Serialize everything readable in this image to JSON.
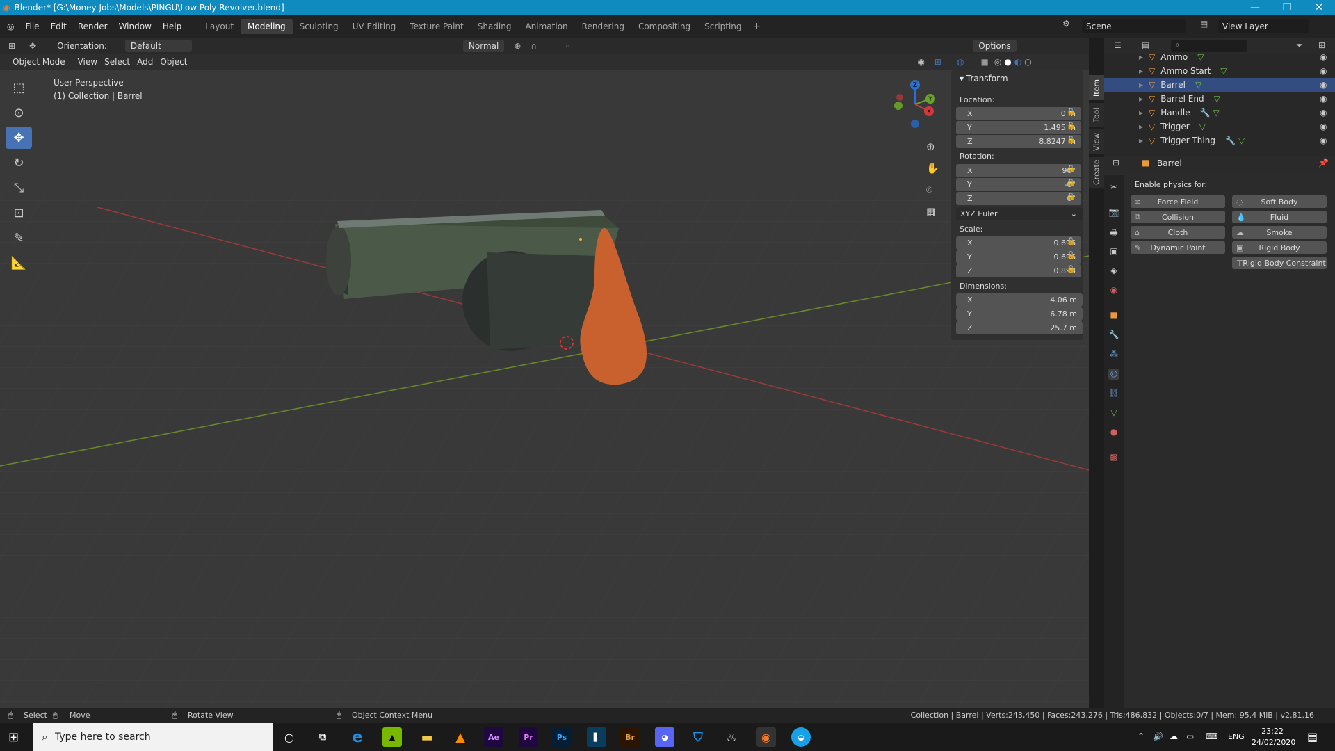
{
  "titlebar": {
    "title": "Blender* [G:\\Money Jobs\\Models\\PINGU\\Low Poly Revolver.blend]"
  },
  "menu": [
    "File",
    "Edit",
    "Render",
    "Window",
    "Help"
  ],
  "workspaces": [
    "Layout",
    "Modeling",
    "Sculpting",
    "UV Editing",
    "Texture Paint",
    "Shading",
    "Animation",
    "Rendering",
    "Compositing",
    "Scripting"
  ],
  "active_workspace": "Modeling",
  "scene": {
    "label": "Scene"
  },
  "viewlayer": {
    "label": "View Layer"
  },
  "header": {
    "orientation_label": "Orientation:",
    "orientation_value": "Default",
    "pivot": "Normal",
    "options": "Options"
  },
  "header2": {
    "mode": "Object Mode",
    "view": "View",
    "select": "Select",
    "add": "Add",
    "object": "Object"
  },
  "viewport": {
    "perspective": "User Perspective",
    "collection": "(1) Collection | Barrel"
  },
  "npanel": {
    "title": "Transform",
    "location_label": "Location:",
    "location": {
      "x": "0 m",
      "y": "1.495 m",
      "z": "8.8247 m"
    },
    "rotation_label": "Rotation:",
    "rotation": {
      "x": "90°",
      "y": "-0°",
      "z": "0°"
    },
    "euler": "XYZ Euler",
    "scale_label": "Scale:",
    "scale": {
      "x": "0.696",
      "y": "0.696",
      "z": "0.893"
    },
    "dimensions_label": "Dimensions:",
    "dimensions": {
      "x": "4.06 m",
      "y": "6.78 m",
      "z": "25.7 m"
    },
    "tabs": [
      "Item",
      "Tool",
      "View",
      "Create"
    ]
  },
  "axis_labels": {
    "x": "X",
    "y": "Y",
    "z": "Z"
  },
  "outliner": {
    "items": [
      "Ammo",
      "Ammo Start",
      "Barrel",
      "Barrel End",
      "Handle",
      "Trigger",
      "Trigger Thing"
    ]
  },
  "properties": {
    "object_name": "Barrel",
    "enable_label": "Enable physics for:",
    "left": [
      "Force Field",
      "Collision",
      "Cloth",
      "Dynamic Paint"
    ],
    "right": [
      "Soft Body",
      "Fluid",
      "Smoke",
      "Rigid Body",
      "Rigid Body Constraint"
    ]
  },
  "status": {
    "select": "Select",
    "move": "Move",
    "rotate": "Rotate View",
    "context": "Object Context Menu",
    "stats": "Collection | Barrel | Verts:243,450 | Faces:243,276 | Tris:486,832 | Objects:0/7 | Mem: 95.4 MiB | v2.81.16"
  },
  "taskbar": {
    "search_placeholder": "Type here to search",
    "lang": "ENG",
    "time": "23:22",
    "date": "24/02/2020"
  },
  "colors": {
    "accent": "#4772b3",
    "titlebar": "#0f8bbf",
    "handle": "#c8612e"
  }
}
